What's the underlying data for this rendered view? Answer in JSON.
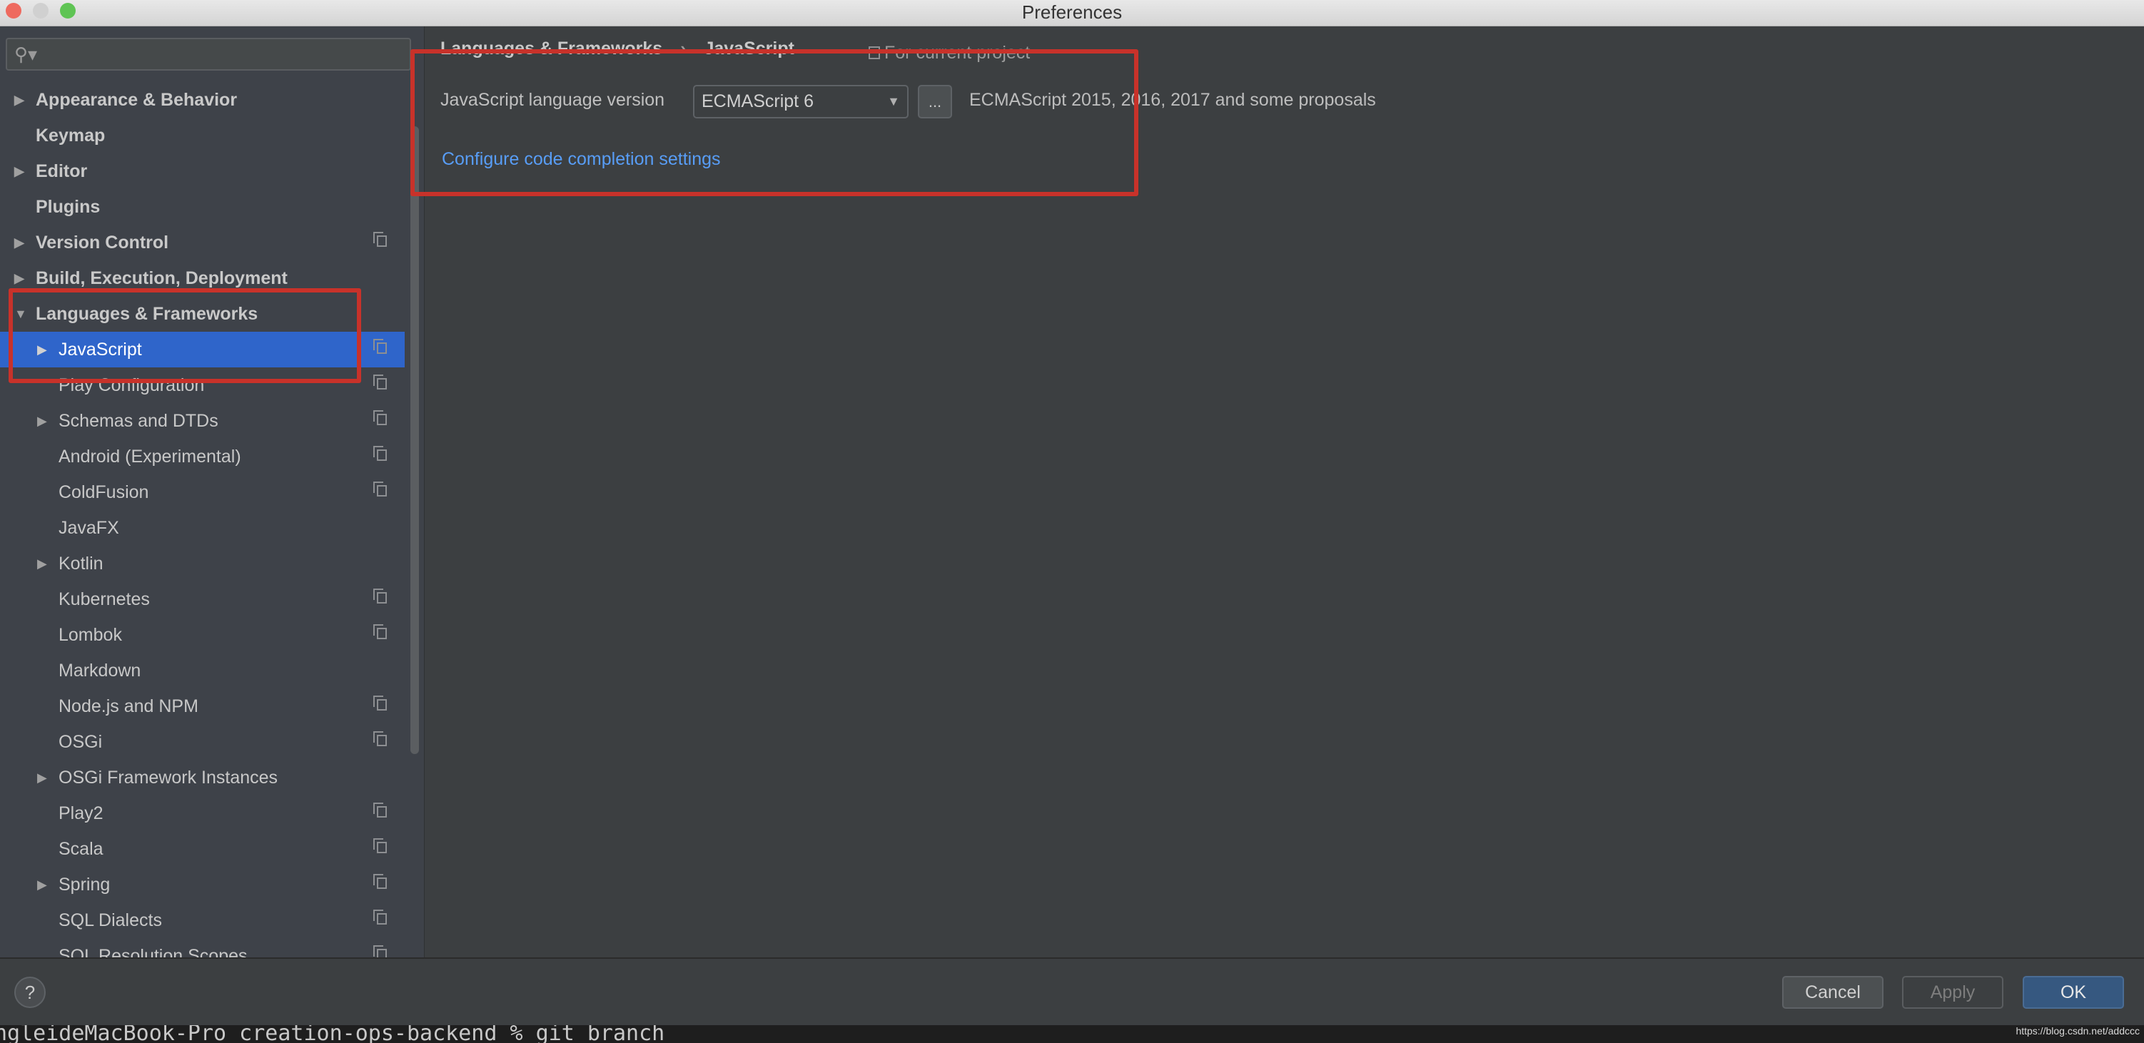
{
  "window": {
    "title": "Preferences"
  },
  "search": {
    "placeholder": "",
    "icon": "search-icon"
  },
  "sidebar": {
    "items": [
      {
        "label": "Appearance & Behavior",
        "level": 0,
        "arrow": "collapsed",
        "copy": false
      },
      {
        "label": "Keymap",
        "level": 0,
        "arrow": "none",
        "copy": false
      },
      {
        "label": "Editor",
        "level": 0,
        "arrow": "collapsed",
        "copy": false
      },
      {
        "label": "Plugins",
        "level": 0,
        "arrow": "none",
        "copy": false
      },
      {
        "label": "Version Control",
        "level": 0,
        "arrow": "collapsed",
        "copy": true
      },
      {
        "label": "Build, Execution, Deployment",
        "level": 0,
        "arrow": "collapsed",
        "copy": false
      },
      {
        "label": "Languages & Frameworks",
        "level": 0,
        "arrow": "expanded",
        "copy": false
      },
      {
        "label": "JavaScript",
        "level": 1,
        "arrow": "collapsed",
        "copy": true,
        "selected": true
      },
      {
        "label": "Play Configuration",
        "level": 1,
        "arrow": "none",
        "copy": true
      },
      {
        "label": "Schemas and DTDs",
        "level": 1,
        "arrow": "collapsed",
        "copy": true
      },
      {
        "label": "Android (Experimental)",
        "level": 1,
        "arrow": "none",
        "copy": true
      },
      {
        "label": "ColdFusion",
        "level": 1,
        "arrow": "none",
        "copy": true
      },
      {
        "label": "JavaFX",
        "level": 1,
        "arrow": "none",
        "copy": false
      },
      {
        "label": "Kotlin",
        "level": 1,
        "arrow": "collapsed",
        "copy": false
      },
      {
        "label": "Kubernetes",
        "level": 1,
        "arrow": "none",
        "copy": true
      },
      {
        "label": "Lombok",
        "level": 1,
        "arrow": "none",
        "copy": true
      },
      {
        "label": "Markdown",
        "level": 1,
        "arrow": "none",
        "copy": false
      },
      {
        "label": "Node.js and NPM",
        "level": 1,
        "arrow": "none",
        "copy": true
      },
      {
        "label": "OSGi",
        "level": 1,
        "arrow": "none",
        "copy": true
      },
      {
        "label": "OSGi Framework Instances",
        "level": 1,
        "arrow": "collapsed",
        "copy": false
      },
      {
        "label": "Play2",
        "level": 1,
        "arrow": "none",
        "copy": true
      },
      {
        "label": "Scala",
        "level": 1,
        "arrow": "none",
        "copy": true
      },
      {
        "label": "Spring",
        "level": 1,
        "arrow": "collapsed",
        "copy": true
      },
      {
        "label": "SQL Dialects",
        "level": 1,
        "arrow": "none",
        "copy": true
      },
      {
        "label": "SQL Resolution Scopes",
        "level": 1,
        "arrow": "none",
        "copy": true
      }
    ]
  },
  "main": {
    "breadcrumb": [
      "Languages & Frameworks",
      "JavaScript"
    ],
    "breadcrumb_sep": "›",
    "scope_label": "For current project",
    "js_version_label": "JavaScript language version",
    "js_version_value": "ECMAScript 6",
    "more_button": "...",
    "js_version_description": "ECMAScript 2015, 2016, 2017 and some proposals",
    "completion_link": "Configure code completion settings"
  },
  "footer": {
    "help": "?",
    "cancel": "Cancel",
    "apply": "Apply",
    "ok": "OK"
  },
  "terminal": {
    "line": "ngleideMacBook-Pro creation-ops-backend % git branch"
  },
  "watermark": "https://blog.csdn.net/addccc",
  "colors": {
    "selection": "#2f65ca",
    "link": "#589df6",
    "annotation": "#c8322a",
    "ok_button": "#365880"
  }
}
